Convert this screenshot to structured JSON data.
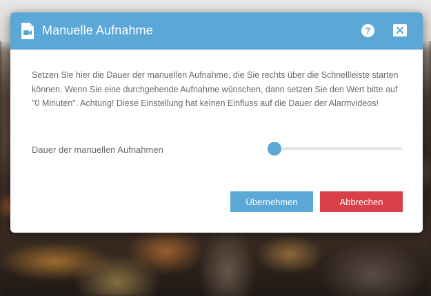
{
  "dialog": {
    "title": "Manuelle Aufnahme",
    "title_icon": "video-file-icon",
    "help_icon": "help-icon",
    "close_icon": "close-icon",
    "description": "Setzen Sie hier die Dauer der manuellen Aufnahme, die Sie rechts über die Schnellleiste starten können. Wenn Sie eine durchgehende Aufnahme wünschen, dann setzen Sie den Wert bitte auf \"0 Minuten\". Achtung! Diese Einstellung hat keinen Einfluss auf die Dauer der Alarmvideos!",
    "slider": {
      "label": "Dauer der manuellen Aufnahmen",
      "fraction": 0.0
    },
    "buttons": {
      "apply": "Übernehmen",
      "cancel": "Abbrechen"
    }
  },
  "colors": {
    "accent": "#5ba8d6",
    "danger": "#d9404a",
    "text": "#6a6a6a"
  }
}
